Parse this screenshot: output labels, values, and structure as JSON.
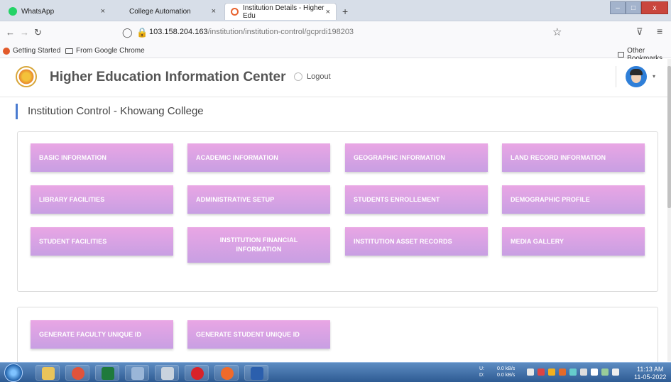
{
  "browser": {
    "tabs": [
      {
        "label": "WhatsApp",
        "close": "×"
      },
      {
        "label": "College Automation",
        "close": "×"
      },
      {
        "label": "Institution Details - Higher Edu",
        "close": "×"
      }
    ],
    "new_tab": "+",
    "window_controls": {
      "minimize": "–",
      "maximize": "□",
      "close": "x"
    },
    "url_host": "103.158.204.163",
    "url_path": "/institution/institution-control/gcprdi198203",
    "bookmarks": [
      "Getting Started",
      "From Google Chrome"
    ],
    "other_bookmarks": "Other Bookmarks"
  },
  "header": {
    "site_title": "Higher Education Information Center",
    "logout_label": "Logout",
    "caret": "▾"
  },
  "page": {
    "title_prefix": "Institution Control - ",
    "college_name": "Khowang College"
  },
  "control_buttons": [
    "BASIC INFORMATION",
    "ACADEMIC INFORMATION",
    "GEOGRAPHIC INFORMATION",
    "LAND RECORD INFORMATION",
    "LIBRARY FACILITIES",
    "ADMINISTRATIVE SETUP",
    "STUDENTS ENROLLEMENT",
    "DEMOGRAPHIC PROFILE",
    "STUDENT FACILITIES",
    "INSTITUTION FINANCIAL INFORMATION",
    "INSTITUTION ASSET RECORDS",
    "MEDIA GALLERY"
  ],
  "id_buttons": [
    "GENERATE FACULTY UNIQUE ID",
    "GENERATE STUDENT UNIQUE ID"
  ],
  "taskbar": {
    "net_up_label": "U:",
    "net_down_label": "D:",
    "net_up": "0.0 kB/s",
    "net_down": "0.0 kB/s",
    "time": "11:13 AM",
    "date": "11-05-2022"
  },
  "colors": {
    "button_gradient_top": "#e9a6e4",
    "button_gradient_bottom": "#c89fe3",
    "college_name": "#f39a0e",
    "title_accent": "#4a7bd0"
  }
}
